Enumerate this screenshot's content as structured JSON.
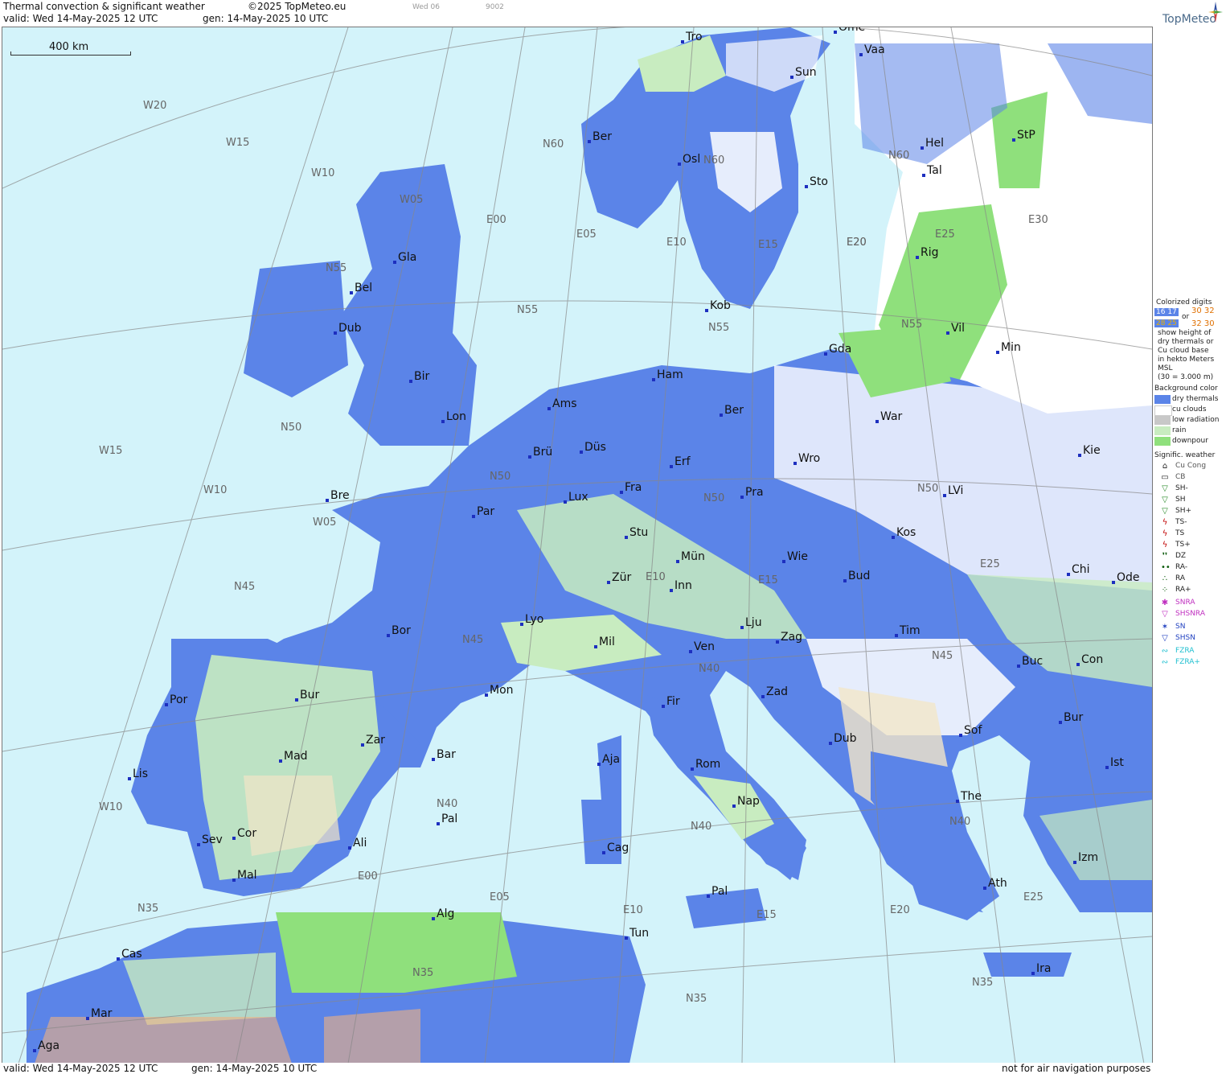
{
  "header": {
    "title": "Thermal convection & significant weather",
    "copyright": "©2025 TopMeteo.eu",
    "run_small": "Wed 06",
    "code_small": "9002",
    "valid": "valid:  Wed  14-May-2025  12 UTC",
    "gen": "gen: 14-May-2025 10 UTC",
    "logo": "TopMeteo"
  },
  "scale": {
    "label": "400 km"
  },
  "grid_labels": [
    "W20",
    "W15",
    "W10",
    "W05",
    "E00",
    "E05",
    "E10",
    "E15",
    "E20",
    "E25",
    "E30",
    "N60",
    "N55",
    "N50",
    "N45",
    "N40",
    "N35",
    "W15",
    "W10",
    "W05",
    "W10",
    "N55",
    "N50",
    "N45",
    "N40",
    "N35",
    "E00",
    "E05",
    "E10",
    "E15",
    "E20",
    "E25",
    "N60",
    "N55",
    "N50",
    "N45",
    "N40",
    "N35",
    "E10",
    "E15",
    "N50",
    "N55",
    "N60",
    "E20",
    "E25",
    "N40",
    "N35"
  ],
  "cities": [
    "Tro",
    "Ome",
    "Vaa",
    "Sun",
    "Ber",
    "Osl",
    "Sto",
    "Hel",
    "StP",
    "Tal",
    "Gla",
    "Bel",
    "Dub",
    "Rig",
    "Kob",
    "Gda",
    "Vil",
    "Min",
    "Ham",
    "Bir",
    "Ams",
    "Ber",
    "Lon",
    "War",
    "Düs",
    "Brü",
    "Erf",
    "Wro",
    "Kie",
    "Bre",
    "Lux",
    "Fra",
    "Pra",
    "Par",
    "LVi",
    "Stu",
    "Kos",
    "Mün",
    "Wie",
    "Bud",
    "Chi",
    "Ode",
    "Zür",
    "Inn",
    "Lju",
    "Lyo",
    "Bor",
    "Mil",
    "Ven",
    "Zag",
    "Tim",
    "Buc",
    "Con",
    "Bur",
    "Por",
    "Mon",
    "Fir",
    "Zad",
    "Zar",
    "Bar",
    "Mad",
    "Sof",
    "Bur",
    "Aja",
    "Dub",
    "Rom",
    "Ist",
    "Lis",
    "Nap",
    "The",
    "Pal",
    "Sev",
    "Cor",
    "Ali",
    "Cag",
    "Mal",
    "Izm",
    "Ath",
    "Pal",
    "Alg",
    "Tun",
    "Cas",
    "Mar",
    "Ira",
    "Aga"
  ],
  "legend": {
    "colorized_title": "Colorized digits",
    "digit_a": "16 17",
    "or": "or",
    "digit_b": "30 32",
    "digit_c": "28 25",
    "digit_d": "32 30",
    "desc1": "show height of",
    "desc2": "dry thermals or",
    "desc3": "Cu cloud base",
    "desc4": "in hekto Meters",
    "desc5": "MSL",
    "desc6": "(30 = 3.000 m)",
    "bg_title": "Background color",
    "bg_items": [
      {
        "label": "dry thermals",
        "color": "#5b84e8"
      },
      {
        "label": "cu clouds",
        "color": "#ffffff"
      },
      {
        "label": "low radiation",
        "color": "#c8c8c8"
      },
      {
        "label": "rain",
        "color": "#c8ecc0"
      },
      {
        "label": "downpour",
        "color": "#8fe07c"
      }
    ],
    "sig_title": "Signific. weather",
    "sig_items": [
      {
        "label": "Cu Cong",
        "glyph": "⌂",
        "color": "#222"
      },
      {
        "label": "CB",
        "glyph": "▭",
        "color": "#222"
      },
      {
        "label": "SH-",
        "glyph": "▽",
        "color": "#2a8a2a"
      },
      {
        "label": "SH",
        "glyph": "▽",
        "color": "#2a8a2a"
      },
      {
        "label": "SH+",
        "glyph": "▽",
        "color": "#2a8a2a"
      },
      {
        "label": "TS-",
        "glyph": "ϟ",
        "color": "#c00000"
      },
      {
        "label": "TS",
        "glyph": "ϟ",
        "color": "#c00000"
      },
      {
        "label": "TS+",
        "glyph": "ϟ",
        "color": "#c00000"
      },
      {
        "label": "DZ",
        "glyph": "❜❜",
        "color": "#0a5a0a"
      },
      {
        "label": "RA-",
        "glyph": "••",
        "color": "#0a5a0a"
      },
      {
        "label": "RA",
        "glyph": "∴",
        "color": "#0a5a0a"
      },
      {
        "label": "RA+",
        "glyph": "⁘",
        "color": "#0a5a0a"
      },
      {
        "label": "SNRA",
        "glyph": "✱",
        "color": "#c030c0"
      },
      {
        "label": "SHSNRA",
        "glyph": "▽",
        "color": "#c030c0"
      },
      {
        "label": "SN",
        "glyph": "✶",
        "color": "#2040c0"
      },
      {
        "label": "SHSN",
        "glyph": "▽",
        "color": "#2040c0"
      },
      {
        "label": "FZRA",
        "glyph": "∾",
        "color": "#20c0d0"
      },
      {
        "label": "FZRA+",
        "glyph": "∾",
        "color": "#20c0d0"
      }
    ]
  },
  "footer": {
    "valid": "valid:  Wed  14-May-2025  12 UTC",
    "gen": "gen: 14-May-2025 10 UTC",
    "note": "not for air navigation purposes"
  },
  "colors": {
    "sea": "#d3f3fa",
    "dry": "#5b84e8",
    "cu": "#ffffff",
    "rain": "#c8ecc0",
    "downpour": "#8fe07c",
    "lowrad": "#c8c8c8"
  }
}
